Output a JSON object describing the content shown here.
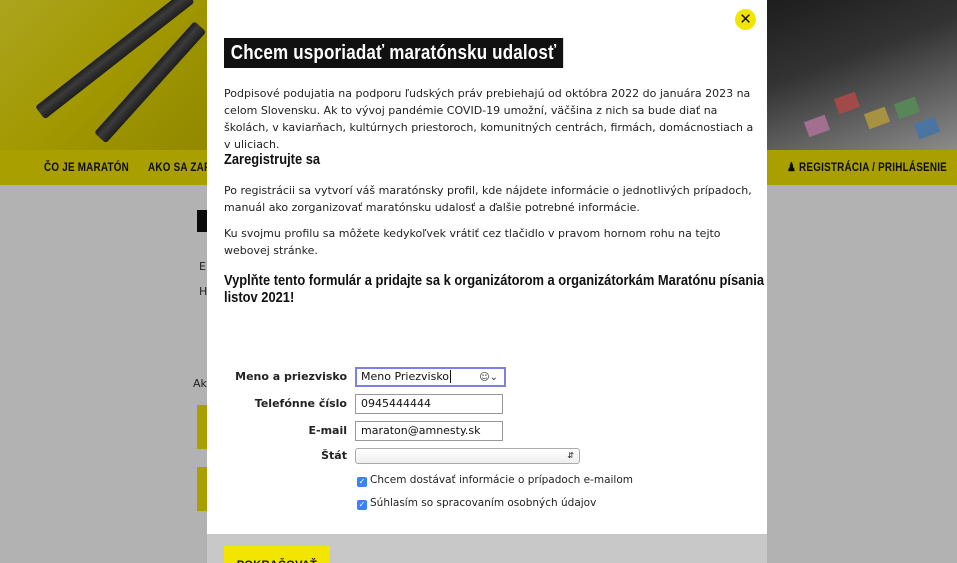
{
  "nav": {
    "items": [
      "ČO JE MARATÓN",
      "AKO SA ZAPOJIŤ"
    ],
    "account": "REGISTRÁCIA / PRIHLÁSENIE"
  },
  "background": {
    "label_e": "E",
    "label_h": "H",
    "label_ak": "Ak"
  },
  "modal": {
    "title": "Chcem usporiadať maratónsku udalosť",
    "close": "✕",
    "intro": "Podpisové podujatia na podporu ľudských práv prebiehajú od októbra 2022 do januára 2023 na celom Slovensku. Ak to vývoj pandémie COVID-19 umožní, väčšina z nich sa bude diať na školách, v kaviarňach, kultúrnych priestoroch, komunitných centrách, firmách, domácnostiach a v uliciach.",
    "register_heading": "Zaregistrujte sa",
    "register_text1": "Po registrácii sa vytvorí váš maratónsky profil, kde nájdete informácie o jednotlivých prípadoch, manuál ako zorganizovať maratónsku udalosť a ďalšie potrebné informácie.",
    "register_text2": "Ku svojmu profilu sa môžete kedykoľvek vrátiť cez tlačidlo v pravom hornom rohu na tejto webovej stránke.",
    "form_heading_line1": "Vyplňte tento formulár a pridajte sa k organizátorom a organizátorkám Maratónu písania",
    "form_heading_line2": "listov 2021!",
    "form": {
      "name_label": "Meno a priezvisko",
      "name_value": "Meno Priezvisko",
      "phone_label": "Telefónne číslo",
      "phone_value": "0945444444",
      "email_label": "E-mail",
      "email_value": "maraton@amnesty.sk",
      "country_label": "Štát",
      "country_value": "",
      "newsletter_label": "Chcem dostávať informácie o prípadoch e-mailom",
      "newsletter_checked": true,
      "consent_label": "Súhlasím so spracovaním osobných údajov",
      "consent_checked": true
    },
    "continue_label": "POKRAČOVAŤ"
  },
  "colors": {
    "accent": "#f2e500",
    "title_bg": "#111111",
    "focus_ring": "#7b7fe6",
    "checkbox": "#3b82f6"
  }
}
